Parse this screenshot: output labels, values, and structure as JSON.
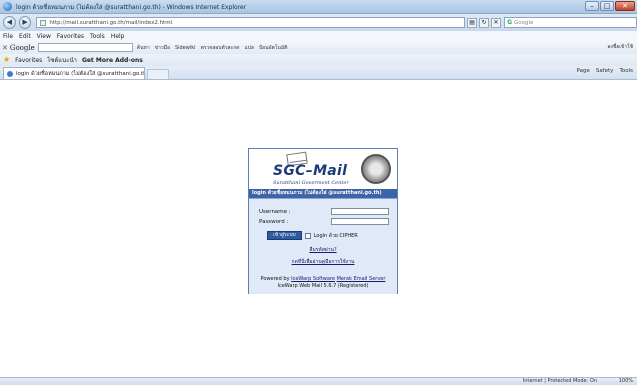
{
  "window": {
    "title": "login ด้วยชื่อหมนภาม (ไม่ต้องใส่ @suratthani.go.th) - Windows Internet Explorer",
    "minimize": "–",
    "maximize": "□",
    "close": "✕"
  },
  "address_bar": {
    "url": "http://mail.suratthani.go.th/mail/index2.html",
    "search_placeholder": "Google",
    "search_engine_label": "G"
  },
  "menu": [
    "File",
    "Edit",
    "View",
    "Favorites",
    "Tools",
    "Help"
  ],
  "google_toolbar": {
    "close": "✕",
    "logo": "Google",
    "items": [
      "ค้นหา",
      "ข่าวมือ",
      "Sidewiki",
      "ตรวจสอบตัวสะกด",
      "แปล",
      "ป้อนอัตโนมัติ"
    ],
    "right": "ลงชื่อเข้าใช้"
  },
  "favorites_bar": {
    "favorites": "Favorites",
    "suggested": "ไซต์แนะนำ",
    "addons": "Get More Add-ons"
  },
  "tab": {
    "title": "login ด้วยชื่อหมนภาม (ไม่ต้องใส่ @suratthani.go.th)"
  },
  "command_bar": [
    "Page",
    "Safety",
    "Tools"
  ],
  "login": {
    "logo_main": "SGC–",
    "logo_mail": "Mail",
    "logo_sub": "Suratthani Goverment Center",
    "header": "login ด้วยชื่อหมนภาม (ไม่ต้องใส่ @suratthani.go.th)",
    "username_label": "Username :",
    "password_label": "Password :",
    "login_button": "เข้าสู่ระบบ",
    "cipher_label": "Login ด้วย CIPHER",
    "forgot_link": "ลืมรหัสผ่าน?",
    "manual_link": "กดที่นี่เพื่ออ่านคู่มือการใช้งาน",
    "powered_prefix": "Powered by",
    "powered_link1": "IceWarp Software",
    "powered_link2": "Merak Email Server",
    "version": "IceWarp Web Mail 5.6.7 (Registered)"
  },
  "status": {
    "zone": "Internet | Protected Mode: On",
    "zoom": "100%"
  }
}
